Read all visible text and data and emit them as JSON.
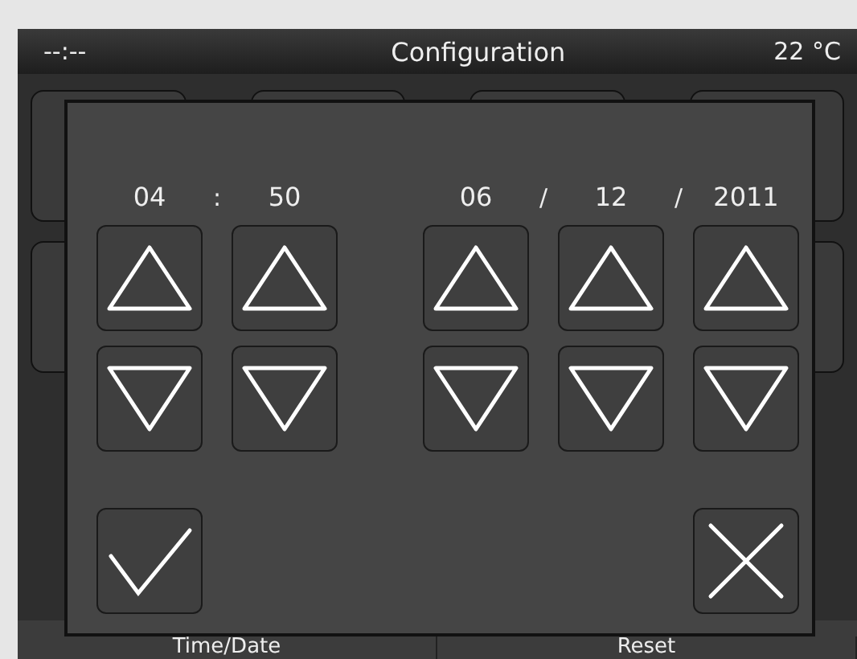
{
  "title_bar": {
    "time": "--:--",
    "title": "Configuration",
    "temperature": "22 °C"
  },
  "dialog": {
    "time_fields": [
      {
        "value": "04"
      },
      {
        "value": "50"
      }
    ],
    "time_separator": ":",
    "date_fields": [
      {
        "value": "06"
      },
      {
        "value": "12"
      },
      {
        "value": "2011"
      }
    ],
    "date_separators": [
      "/",
      "/"
    ]
  },
  "bottom_tabs": [
    "Time/Date",
    "Reset"
  ]
}
